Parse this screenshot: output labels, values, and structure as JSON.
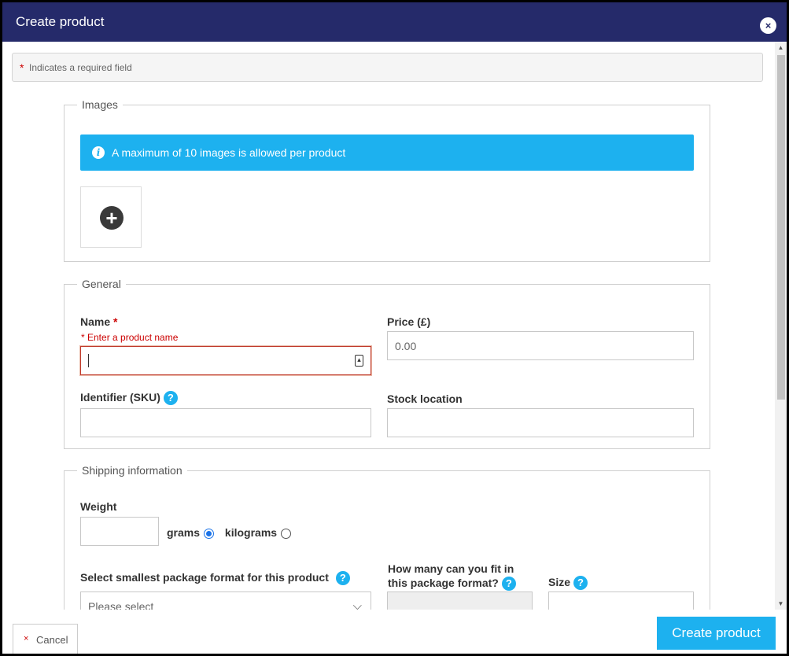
{
  "dialog": {
    "title": "Create product",
    "close_icon": "close-icon",
    "close_glyph": "×"
  },
  "required_note": {
    "star": "*",
    "text": "Indicates a required field"
  },
  "images": {
    "legend": "Images",
    "info_text": "A maximum of 10 images is allowed per product",
    "info_glyph": "i",
    "add_glyph": "+"
  },
  "general": {
    "legend": "General",
    "name_label": "Name",
    "required_star": "*",
    "name_error": "* Enter a product name",
    "name_value": "",
    "price_label": "Price (£)",
    "price_placeholder": "0.00",
    "sku_label": "Identifier (SKU)",
    "stock_label": "Stock location",
    "help_glyph": "?"
  },
  "shipping": {
    "legend": "Shipping information",
    "weight_label": "Weight",
    "grams_label": "grams",
    "kilograms_label": "kilograms",
    "selected_unit": "grams",
    "package_label": "Select smallest package format for this product",
    "package_placeholder": "Please select",
    "fit_label_line1": "How many can you fit in",
    "fit_label_line2": "this package format?",
    "size_label": "Size",
    "chevron_glyph": "⌵"
  },
  "footer": {
    "cancel_glyph": "×",
    "cancel_label": "Cancel",
    "create_label": "Create product"
  },
  "scrollbar": {
    "up_glyph": "▲",
    "down_glyph": "▼"
  },
  "colors": {
    "header_bg": "#252a6a",
    "accent": "#1db1ef",
    "error": "#c00000"
  }
}
